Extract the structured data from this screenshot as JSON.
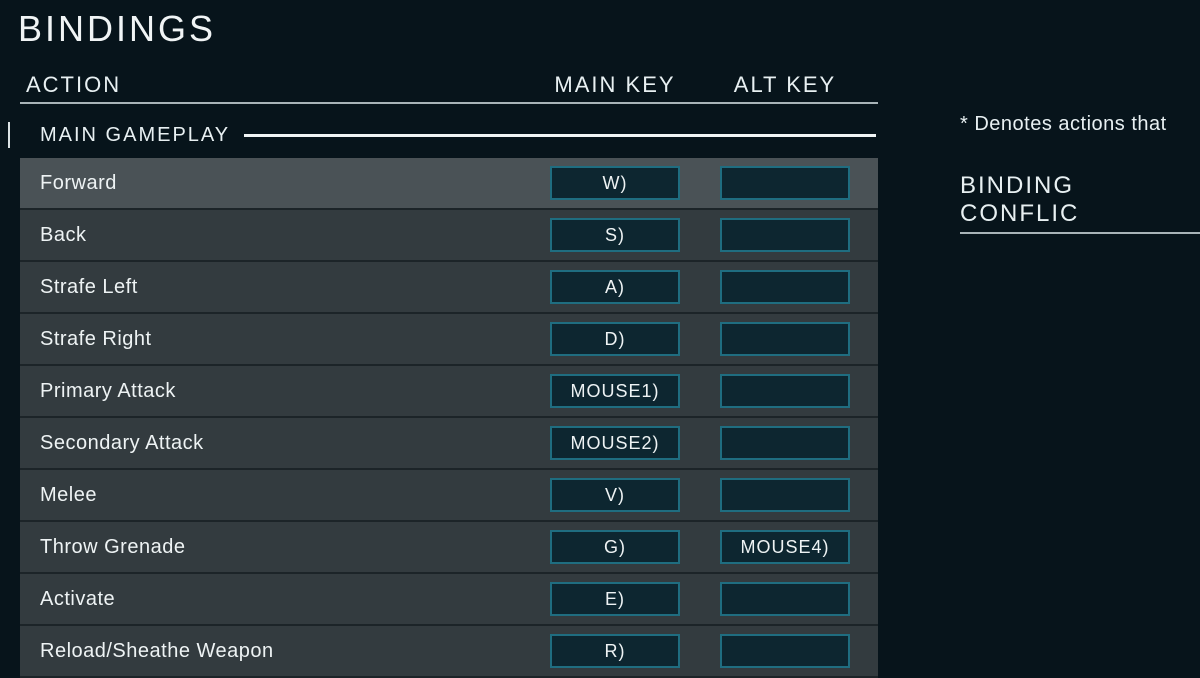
{
  "title": "BINDINGS",
  "columns": {
    "action": "ACTION",
    "main": "MAIN KEY",
    "alt": "ALT KEY"
  },
  "section": "MAIN GAMEPLAY",
  "bindings": [
    {
      "action": "Forward",
      "main": "W)",
      "alt": ""
    },
    {
      "action": "Back",
      "main": "S)",
      "alt": ""
    },
    {
      "action": "Strafe Left",
      "main": "A)",
      "alt": ""
    },
    {
      "action": "Strafe Right",
      "main": "D)",
      "alt": ""
    },
    {
      "action": "Primary Attack",
      "main": "MOUSE1)",
      "alt": ""
    },
    {
      "action": "Secondary Attack",
      "main": "MOUSE2)",
      "alt": ""
    },
    {
      "action": "Melee",
      "main": "V)",
      "alt": ""
    },
    {
      "action": "Throw Grenade",
      "main": "G)",
      "alt": "MOUSE4)"
    },
    {
      "action": "Activate",
      "main": "E)",
      "alt": ""
    },
    {
      "action": "Reload/Sheathe Weapon",
      "main": "R)",
      "alt": ""
    }
  ],
  "side": {
    "note": "* Denotes actions that",
    "heading": "BINDING CONFLIC"
  }
}
